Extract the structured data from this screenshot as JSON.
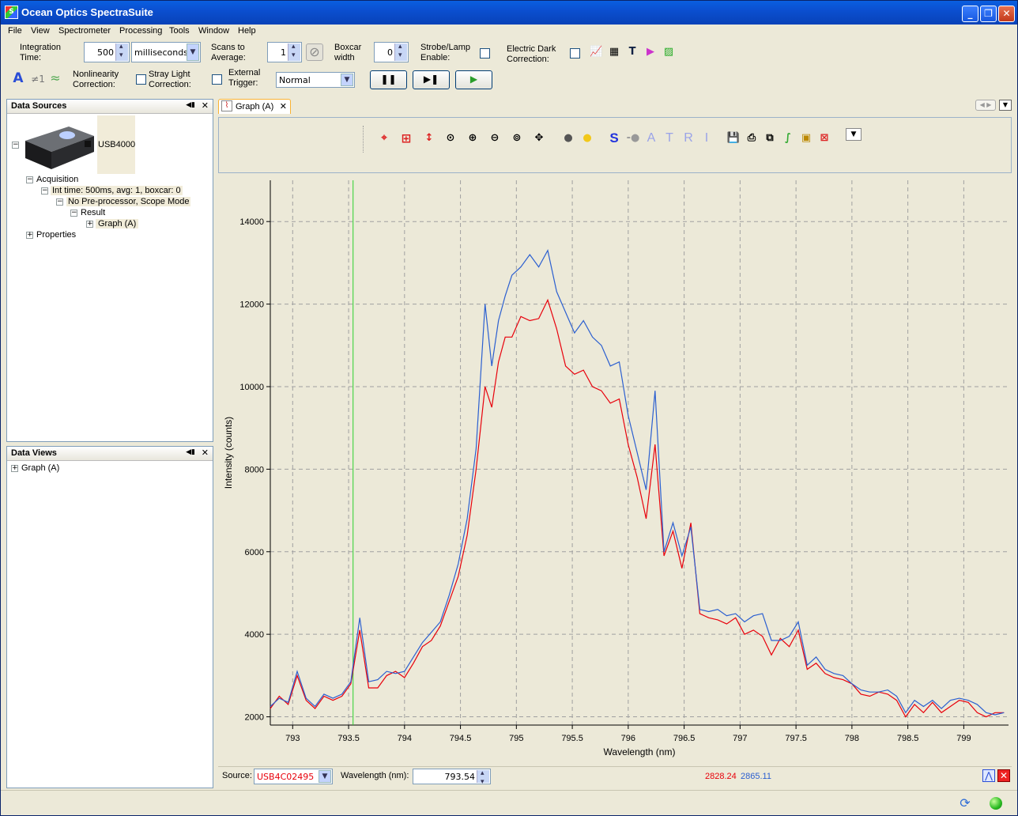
{
  "window": {
    "title": "Ocean Optics SpectraSuite"
  },
  "menu": [
    "File",
    "View",
    "Spectrometer",
    "Processing",
    "Tools",
    "Window",
    "Help"
  ],
  "acq": {
    "integration_label_1": "Integration",
    "integration_label_2": "Time:",
    "integration_value": "500",
    "integration_unit": "milliseconds",
    "scans_label_1": "Scans to",
    "scans_label_2": "Average:",
    "scans_value": "1",
    "boxcar_label_1": "Boxcar",
    "boxcar_label_2": "width",
    "boxcar_value": "0",
    "strobe_label_1": "Strobe/Lamp",
    "strobe_label_2": "Enable:",
    "dark_label_1": "Electric Dark",
    "dark_label_2": "Correction:",
    "nonlin_label_1": "Nonlinearity",
    "nonlin_label_2": "Correction:",
    "stray_label_1": "Stray Light",
    "stray_label_2": "Correction:",
    "trigger_label_1": "External",
    "trigger_label_2": "Trigger:",
    "trigger_mode": "Normal"
  },
  "data_sources": {
    "title": "Data Sources",
    "device": "USB4000",
    "acquisition": "Acquisition",
    "int_time": "Int time: 500ms, avg: 1, boxcar: 0",
    "preprocessor": "No Pre-processor, Scope Mode",
    "result": "Result",
    "graph": "Graph (A)",
    "properties": "Properties"
  },
  "data_views": {
    "title": "Data Views",
    "item": "Graph (A)"
  },
  "graph_tab": {
    "label": "Graph (A)"
  },
  "graph_toolbar": {
    "letters": [
      "S",
      "A",
      "T",
      "R",
      "I"
    ]
  },
  "status": {
    "source_label": "Source:",
    "source_value": "USB4C02495",
    "wavelength_label": "Wavelength (nm):",
    "wavelength_value": "793.54",
    "value_red": "2828.24",
    "value_blue": "2865.11",
    "color_red": "#e8000b",
    "color_blue": "#2b5fd0"
  },
  "chart_data": {
    "type": "line",
    "xlabel": "Wavelength (nm)",
    "ylabel": "Intensity (counts)",
    "xlim": [
      792.8,
      799.4
    ],
    "ylim": [
      1800,
      15000
    ],
    "xticks": [
      793,
      793.5,
      794,
      794.5,
      795,
      795.5,
      796,
      796.5,
      797,
      797.5,
      798,
      798.5,
      799
    ],
    "yticks": [
      2000,
      4000,
      6000,
      8000,
      10000,
      12000,
      14000
    ],
    "cursor_x": 793.54,
    "grid": true,
    "x": [
      792.8,
      792.88,
      792.96,
      793.04,
      793.12,
      793.2,
      793.28,
      793.36,
      793.44,
      793.52,
      793.6,
      793.68,
      793.76,
      793.84,
      793.92,
      794.0,
      794.08,
      794.16,
      794.24,
      794.32,
      794.4,
      794.48,
      794.56,
      794.64,
      794.72,
      794.78,
      794.84,
      794.9,
      794.96,
      795.04,
      795.12,
      795.2,
      795.28,
      795.36,
      795.44,
      795.52,
      795.6,
      795.68,
      795.76,
      795.84,
      795.92,
      796.0,
      796.08,
      796.16,
      796.24,
      796.32,
      796.4,
      796.48,
      796.56,
      796.64,
      796.72,
      796.8,
      796.88,
      796.96,
      797.04,
      797.12,
      797.2,
      797.28,
      797.36,
      797.44,
      797.52,
      797.6,
      797.68,
      797.76,
      797.84,
      797.92,
      798.0,
      798.08,
      798.16,
      798.24,
      798.32,
      798.4,
      798.48,
      798.56,
      798.64,
      798.72,
      798.8,
      798.88,
      798.96,
      799.04,
      799.12,
      799.2,
      799.28,
      799.36
    ],
    "series": [
      {
        "color": "#e8000b",
        "values": [
          2200,
          2500,
          2300,
          3000,
          2400,
          2200,
          2500,
          2400,
          2500,
          2800,
          4100,
          2700,
          2700,
          3000,
          3100,
          2950,
          3300,
          3700,
          3850,
          4200,
          4800,
          5400,
          6400,
          8000,
          10000,
          9500,
          10600,
          11200,
          11200,
          11700,
          11600,
          11650,
          12100,
          11400,
          10500,
          10300,
          10400,
          10000,
          9900,
          9600,
          9700,
          8600,
          7800,
          6800,
          8600,
          5900,
          6500,
          5600,
          6700,
          4500,
          4400,
          4350,
          4250,
          4400,
          4000,
          4100,
          3950,
          3500,
          3900,
          3700,
          4100,
          3150,
          3300,
          3050,
          2950,
          2900,
          2800,
          2550,
          2500,
          2600,
          2550,
          2400,
          2000,
          2300,
          2100,
          2350,
          2100,
          2250,
          2400,
          2350,
          2100,
          2000,
          2100,
          2100
        ]
      },
      {
        "color": "#2b5fd0",
        "values": [
          2250,
          2450,
          2350,
          3100,
          2450,
          2250,
          2550,
          2450,
          2550,
          2850,
          4400,
          2850,
          2900,
          3100,
          3050,
          3100,
          3450,
          3800,
          4050,
          4300,
          4950,
          5700,
          6800,
          8500,
          12000,
          10500,
          11600,
          12200,
          12700,
          12900,
          13200,
          12900,
          13300,
          12300,
          11800,
          11300,
          11600,
          11200,
          11000,
          10500,
          10600,
          9300,
          8400,
          7500,
          9900,
          6000,
          6700,
          5900,
          6600,
          4600,
          4550,
          4600,
          4450,
          4500,
          4300,
          4450,
          4500,
          3850,
          3850,
          3950,
          4300,
          3250,
          3450,
          3150,
          3050,
          3000,
          2800,
          2650,
          2600,
          2600,
          2650,
          2500,
          2100,
          2400,
          2250,
          2400,
          2200,
          2400,
          2450,
          2400,
          2300,
          2100,
          2050,
          2100
        ]
      }
    ]
  }
}
